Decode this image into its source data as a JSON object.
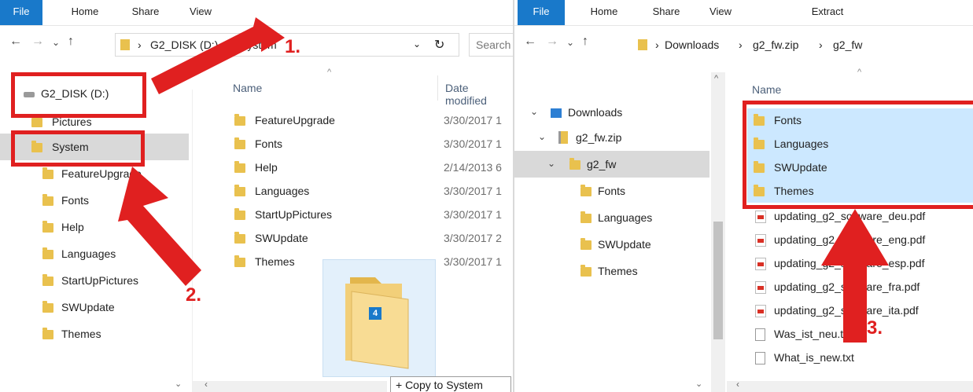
{
  "left": {
    "ribbon_tabs": [
      "File",
      "Home",
      "Share",
      "View"
    ],
    "path": [
      "G2_DISK (D:)",
      "System"
    ],
    "search_placeholder": "Search",
    "nav_items": [
      "G2_DISK (D:)",
      "Pictures",
      "System",
      "FeatureUpgrade",
      "Fonts",
      "Help",
      "Languages",
      "StartUpPictures",
      "SWUpdate",
      "Themes"
    ],
    "columns": {
      "name": "Name",
      "date": "Date modified"
    },
    "files": [
      {
        "name": "FeatureUpgrade",
        "date": "3/30/2017 1"
      },
      {
        "name": "Fonts",
        "date": "3/30/2017 1"
      },
      {
        "name": "Help",
        "date": "2/14/2013 6"
      },
      {
        "name": "Languages",
        "date": "3/30/2017 1"
      },
      {
        "name": "StartUpPictures",
        "date": "3/30/2017 1"
      },
      {
        "name": "SWUpdate",
        "date": "3/30/2017 2"
      },
      {
        "name": "Themes",
        "date": "3/30/2017 1"
      }
    ],
    "drag_count": "4",
    "copy_tooltip": "+ Copy to System"
  },
  "right": {
    "ribbon_tabs": [
      "File",
      "Home",
      "Share",
      "View",
      "Extract"
    ],
    "path": [
      "Downloads",
      "g2_fw.zip",
      "g2_fw"
    ],
    "nav_items": [
      "Downloads",
      "g2_fw.zip",
      "g2_fw",
      "Fonts",
      "Languages",
      "SWUpdate",
      "Themes"
    ],
    "columns": {
      "name": "Name"
    },
    "files": [
      {
        "name": "Fonts",
        "type": "folder"
      },
      {
        "name": "Languages",
        "type": "folder"
      },
      {
        "name": "SWUpdate",
        "type": "folder"
      },
      {
        "name": "Themes",
        "type": "folder"
      },
      {
        "name": "updating_g2_software_deu.pdf",
        "type": "pdf"
      },
      {
        "name": "updating_g2_software_eng.pdf",
        "type": "pdf"
      },
      {
        "name": "updating_g2_software_esp.pdf",
        "type": "pdf"
      },
      {
        "name": "updating_g2_software_fra.pdf",
        "type": "pdf"
      },
      {
        "name": "updating_g2_software_ita.pdf",
        "type": "pdf"
      },
      {
        "name": "Was_ist_neu.txt",
        "type": "txt"
      },
      {
        "name": "What_is_new.txt",
        "type": "txt"
      }
    ]
  },
  "annotations": [
    "1.",
    "2.",
    "3."
  ],
  "colors": {
    "accent": "#1979ca",
    "annotation_red": "#e02020",
    "selection": "#cce8ff",
    "folder": "#e9c14e"
  },
  "icons": {
    "back": "arrow-left-icon",
    "forward": "arrow-right-icon",
    "up": "arrow-up-icon",
    "refresh": "refresh-icon",
    "drive": "drive-icon",
    "zip": "zip-folder-icon"
  }
}
